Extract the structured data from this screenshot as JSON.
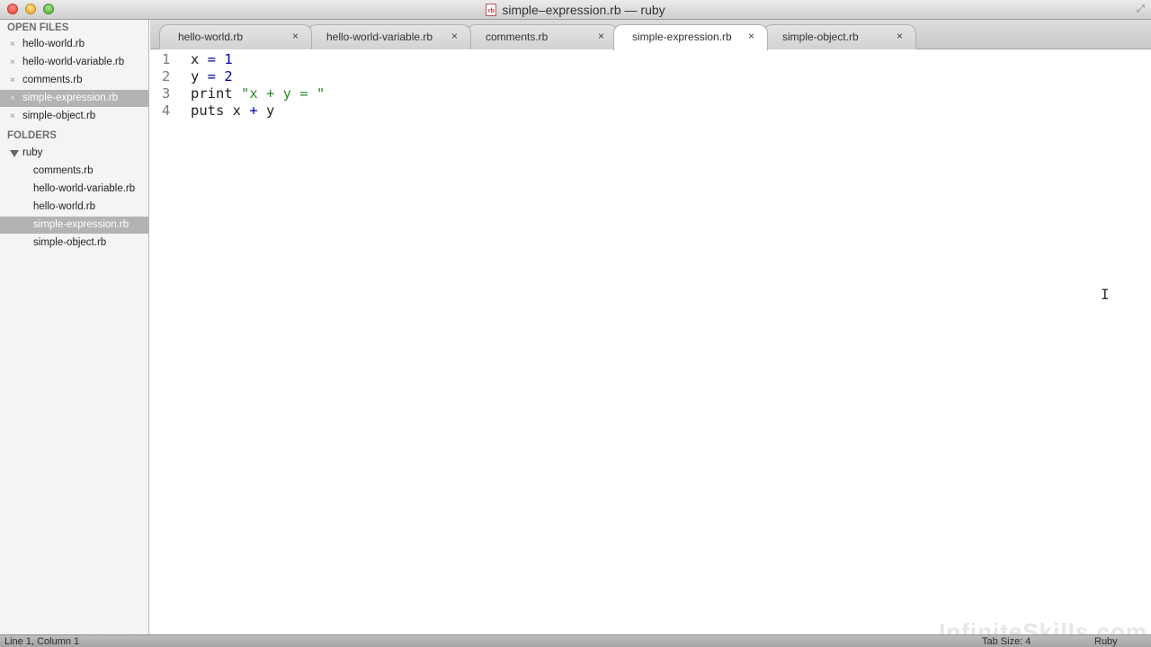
{
  "window": {
    "title": "simple–expression.rb — ruby",
    "file_icon_text": "rb"
  },
  "sidebar": {
    "open_files_header": "OPEN FILES",
    "open_files": [
      {
        "label": "hello-world.rb",
        "selected": false
      },
      {
        "label": "hello-world-variable.rb",
        "selected": false
      },
      {
        "label": "comments.rb",
        "selected": false
      },
      {
        "label": "simple-expression.rb",
        "selected": true
      },
      {
        "label": "simple-object.rb",
        "selected": false
      }
    ],
    "close_glyph": "×",
    "folders_header": "FOLDERS",
    "folder": {
      "label": "ruby"
    },
    "folder_files": [
      {
        "label": "comments.rb",
        "selected": false
      },
      {
        "label": "hello-world-variable.rb",
        "selected": false
      },
      {
        "label": "hello-world.rb",
        "selected": false
      },
      {
        "label": "simple-expression.rb",
        "selected": true
      },
      {
        "label": "simple-object.rb",
        "selected": false
      }
    ]
  },
  "tabs": [
    {
      "label": "hello-world.rb",
      "active": false
    },
    {
      "label": "hello-world-variable.rb",
      "active": false
    },
    {
      "label": "comments.rb",
      "active": false
    },
    {
      "label": "simple-expression.rb",
      "active": true
    },
    {
      "label": "simple-object.rb",
      "active": false
    }
  ],
  "editor": {
    "lines": [
      {
        "num": "1",
        "tokens": [
          {
            "t": "x ",
            "c": "plain"
          },
          {
            "t": "=",
            "c": "op"
          },
          {
            "t": " ",
            "c": "plain"
          },
          {
            "t": "1",
            "c": "num"
          }
        ]
      },
      {
        "num": "2",
        "tokens": [
          {
            "t": "y ",
            "c": "plain"
          },
          {
            "t": "=",
            "c": "op"
          },
          {
            "t": " ",
            "c": "plain"
          },
          {
            "t": "2",
            "c": "num"
          }
        ]
      },
      {
        "num": "3",
        "tokens": [
          {
            "t": "print ",
            "c": "plain"
          },
          {
            "t": "\"x + y = \"",
            "c": "str"
          }
        ]
      },
      {
        "num": "4",
        "tokens": [
          {
            "t": "puts x ",
            "c": "plain"
          },
          {
            "t": "+",
            "c": "op"
          },
          {
            "t": " y",
            "c": "plain"
          }
        ]
      }
    ]
  },
  "statusbar": {
    "position": "Line 1, Column 1",
    "tab_size": "Tab Size: 4",
    "syntax": "Ruby"
  },
  "watermark": "InfiniteSkills.com",
  "colors": {
    "keyword_operator": "#0000b0",
    "string": "#2c8a2c",
    "selected_row": "#b3b3b3"
  }
}
